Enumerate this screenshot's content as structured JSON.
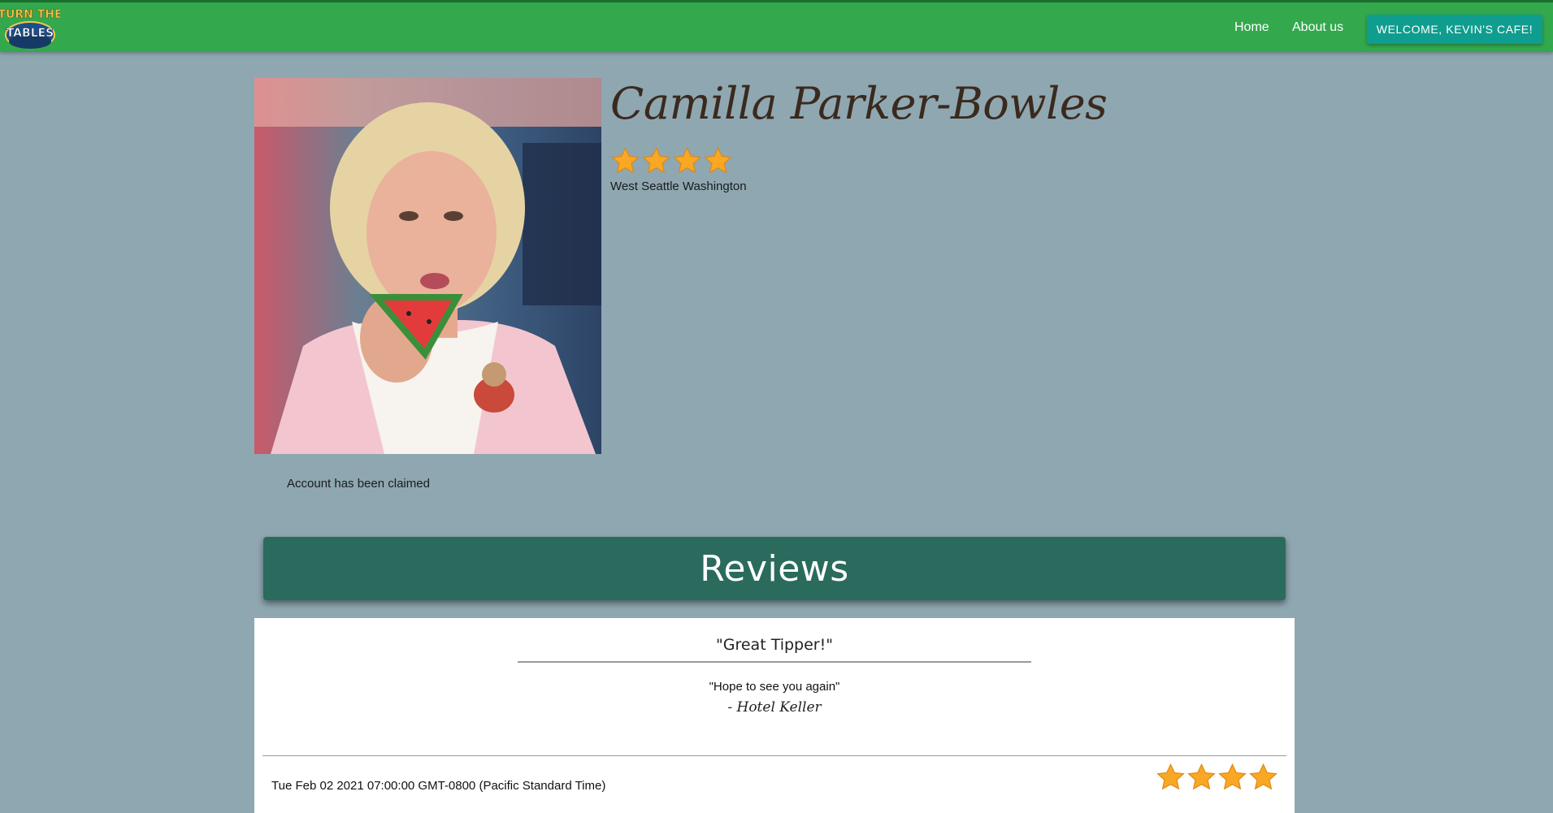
{
  "header": {
    "logo_text_top": "TURN THE",
    "logo_text_bottom": "TABLES",
    "nav": [
      {
        "label": "Home"
      },
      {
        "label": "About us"
      }
    ],
    "welcome_button": "WELCOME, KEVIN'S CAFE!"
  },
  "profile": {
    "name": "Camilla Parker-Bowles",
    "rating": 4,
    "rating_max": 4,
    "location": "West Seattle Washington",
    "photo_icon": "profile-photo",
    "claimed_status": "Account has been claimed"
  },
  "reviews": {
    "section_title": "Reviews",
    "items": [
      {
        "title": "\"Great Tipper!\"",
        "body": "\"Hope to see you again\"",
        "author": "- Hotel Keller",
        "date": "Tue Feb 02 2021 07:00:00 GMT-0800 (Pacific Standard Time)",
        "rating": 4
      }
    ]
  },
  "colors": {
    "page_background": "#8fa7b1",
    "navbar": "#33a84d",
    "welcome_button": "#0f9d8f",
    "reviews_banner": "#2a6b5d",
    "star": "#f9a825"
  }
}
